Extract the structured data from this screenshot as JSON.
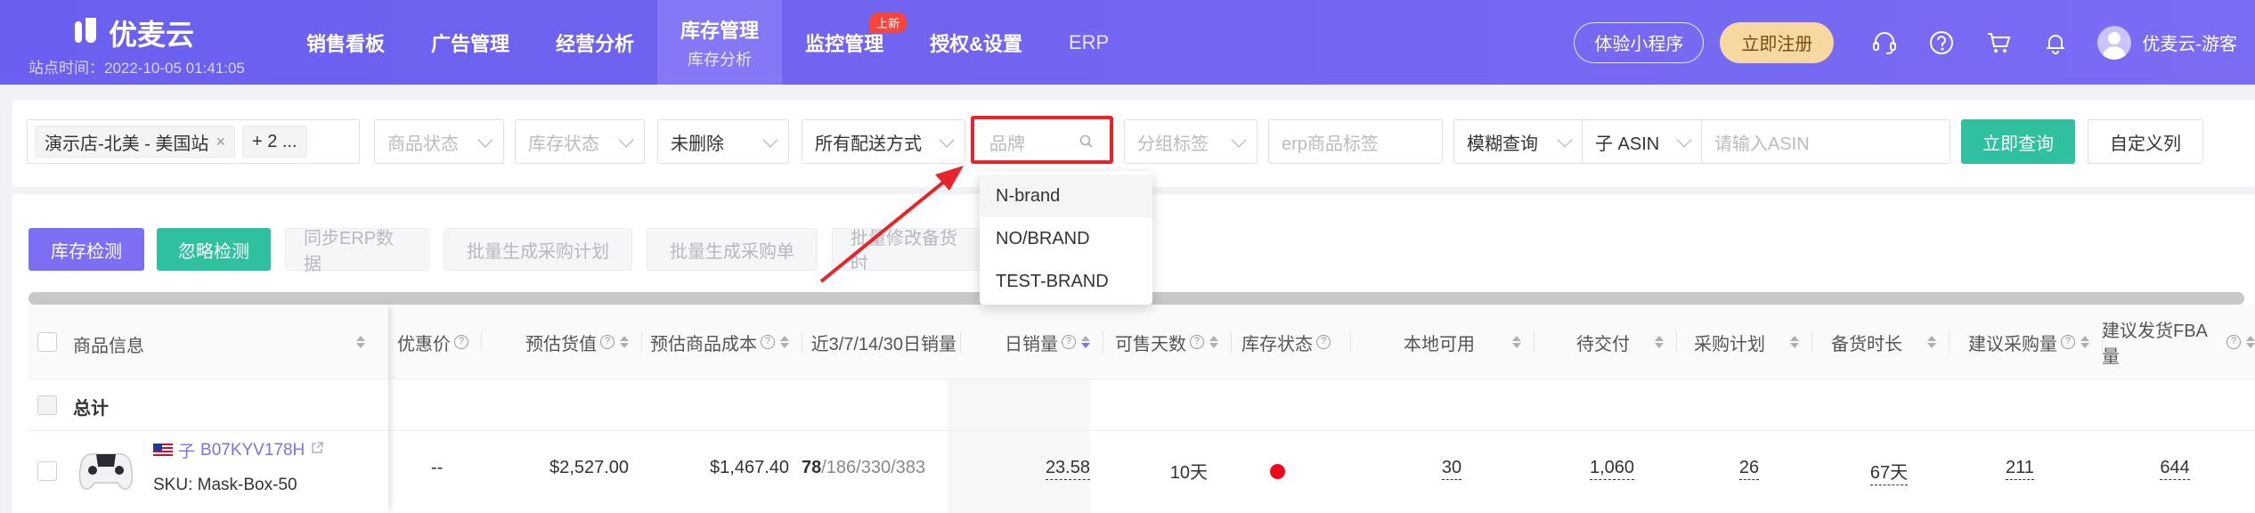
{
  "app": {
    "name": "优麦云",
    "site_time": "站点时间：2022-10-05 01:41:05"
  },
  "nav": {
    "items": [
      {
        "label": "销售看板"
      },
      {
        "label": "广告管理"
      },
      {
        "label": "经营分析"
      },
      {
        "label": "库存管理",
        "sub": "库存分析",
        "active": true
      },
      {
        "label": "监控管理",
        "badge": "上新"
      },
      {
        "label": "授权&设置"
      },
      {
        "label": "ERP"
      }
    ],
    "trial_button": "体验小程序",
    "register_button": "立即注册",
    "username": "优麦云-游客"
  },
  "filters": {
    "store_tag": "演示店-北美 - 美国站",
    "store_more": "+ 2 ...",
    "product_status_placeholder": "商品状态",
    "stock_status_placeholder": "库存状态",
    "delete_status": "未删除",
    "delivery": "所有配送方式",
    "brand_placeholder": "品牌",
    "group_tag_placeholder": "分组标签",
    "erp_tag_placeholder": "erp商品标签",
    "match_mode": "模糊查询",
    "asin_type": "子 ASIN",
    "asin_placeholder": "请输入ASIN",
    "query_button": "立即查询",
    "custom_columns_button": "自定义列"
  },
  "brand_dropdown": {
    "options": [
      "N-brand",
      "NO/BRAND",
      "TEST-BRAND"
    ]
  },
  "actions": {
    "stock_check": "库存检测",
    "ignore_check": "忽略检测",
    "sync_erp": "同步ERP数据",
    "batch_purchase_plan": "批量生成采购计划",
    "batch_purchase_order": "批量生成采购单",
    "batch_modify": "批量修改备货时"
  },
  "table": {
    "headers": {
      "product_info": "商品信息",
      "discount_price": "优惠价",
      "est_value": "预估货值",
      "est_cost": "预估商品成本",
      "recent_sales": "近3/7/14/30日销量",
      "daily_sales": "日销量",
      "sellable_days": "可售天数",
      "stock_status": "库存状态",
      "local_available": "本地可用",
      "pending_delivery": "待交付",
      "purchase_plan": "采购计划",
      "stock_duration": "备货时长",
      "suggested_purchase": "建议采购量",
      "suggested_fba": "建议发货FBA量"
    },
    "total_label": "总计",
    "rows": [
      {
        "flag_label": "子",
        "asin": "B07KYV178H",
        "sku": "SKU: Mask-Box-50",
        "discount_price": "--",
        "est_value": "$2,527.00",
        "est_cost": "$1,467.40",
        "recent_sales_main": "78",
        "recent_sales_rest": "/186/330/383",
        "daily_sales": "23.58",
        "sellable_days": "10天",
        "stock_status_color": "#f0081c",
        "local_available": "30",
        "pending_delivery": "1,060",
        "purchase_plan": "26",
        "stock_duration": "67天",
        "suggested_purchase": "211",
        "suggested_fba": "644"
      }
    ]
  },
  "colors": {
    "nav_bg": "#6c63f0",
    "primary": "#7c6ff3",
    "green": "#2fc0a0",
    "highlight_red": "#e8232a"
  }
}
